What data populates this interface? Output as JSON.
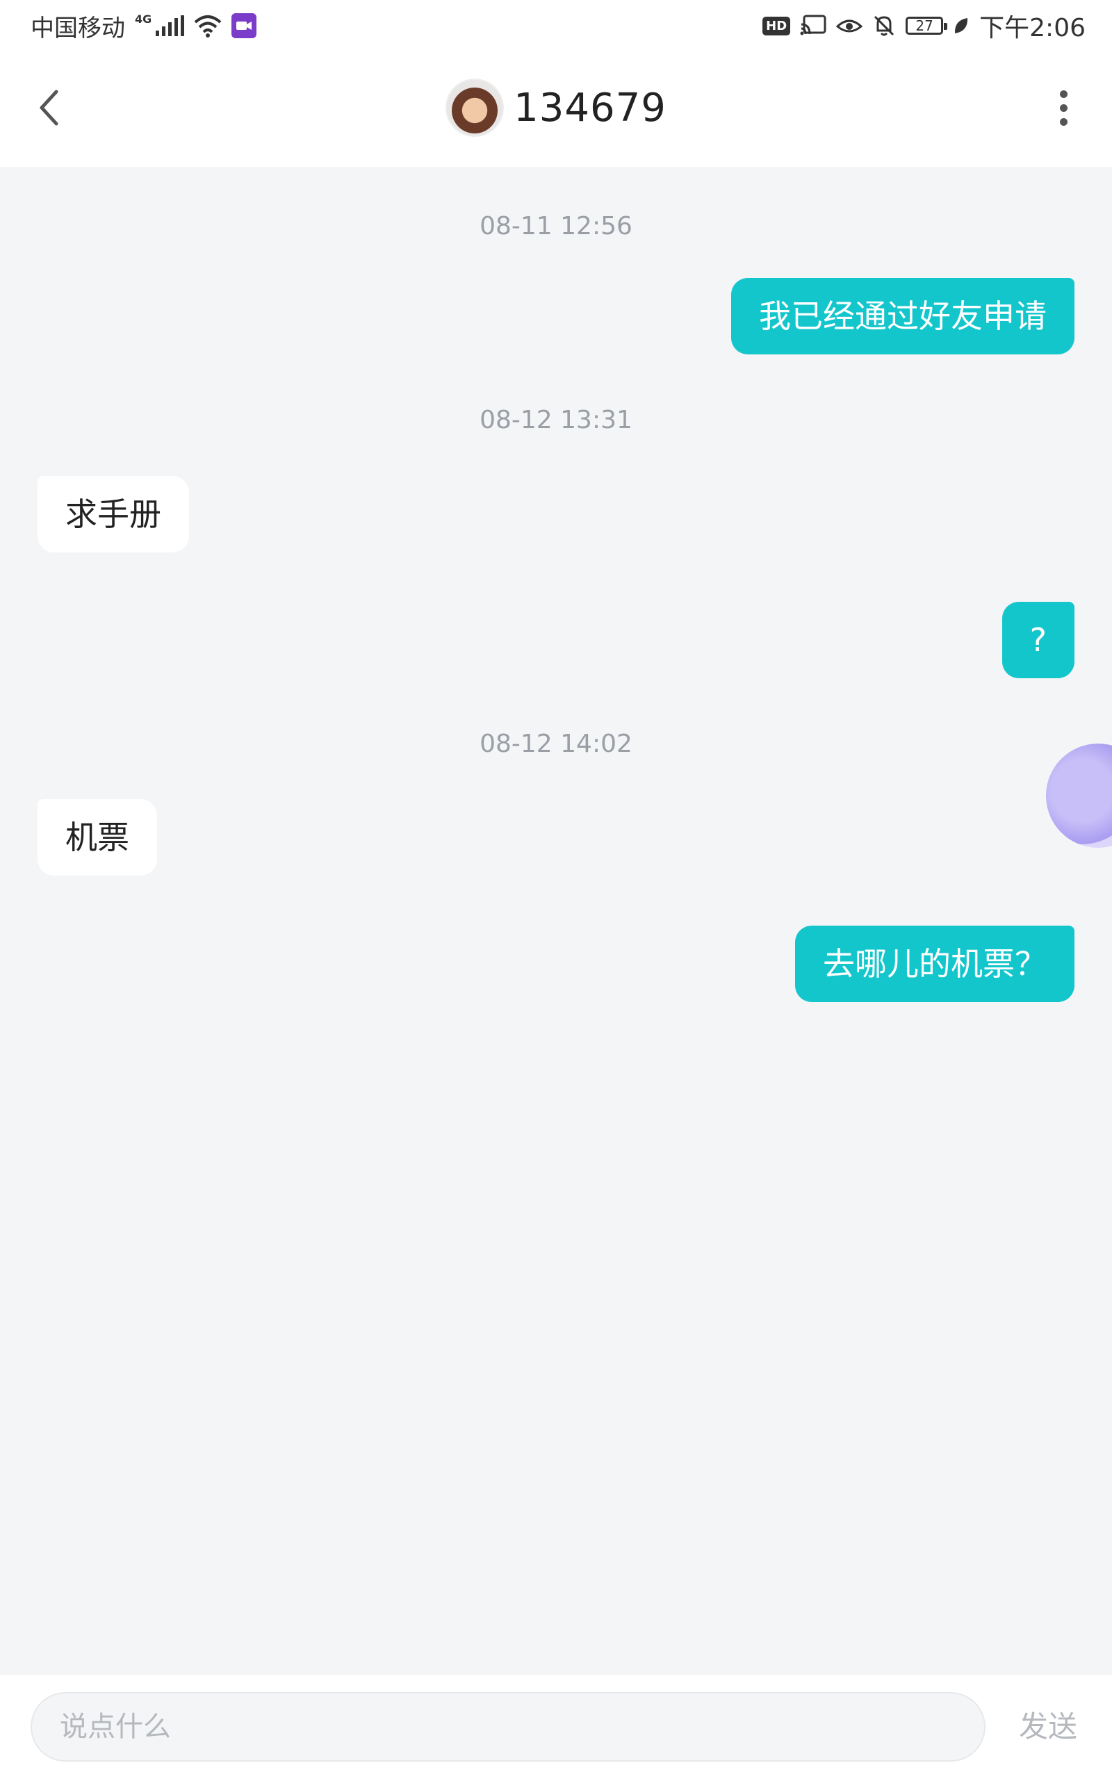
{
  "status_bar": {
    "carrier": "中国移动",
    "network": "4G",
    "time": "下午2:06",
    "hd_label": "HD",
    "battery": "27",
    "icons": [
      "signal-icon",
      "wifi-icon",
      "video-app-icon",
      "hd-icon",
      "cast-icon",
      "eye-icon",
      "mute-icon",
      "battery-icon",
      "leaf-icon"
    ]
  },
  "header": {
    "title": "134679",
    "back_icon": "chevron-left-icon",
    "more_icon": "more-vertical-icon"
  },
  "messages": [
    {
      "type": "time",
      "text": "08-11 12:56"
    },
    {
      "type": "out",
      "text": "我已经通过好友申请"
    },
    {
      "type": "time",
      "text": "08-12 13:31"
    },
    {
      "type": "in",
      "text": "求手册"
    },
    {
      "type": "out",
      "text": "?"
    },
    {
      "type": "time",
      "text": "08-12 14:02"
    },
    {
      "type": "in",
      "text": "机票"
    },
    {
      "type": "out",
      "text": "去哪儿的机票？"
    }
  ],
  "composer": {
    "placeholder": "说点什么",
    "send_label": "发送"
  },
  "colors": {
    "outgoing_bubble": "#13c6cc",
    "incoming_bubble": "#ffffff",
    "chat_background": "#f4f5f7",
    "timestamp_text": "#9a9ea5"
  }
}
